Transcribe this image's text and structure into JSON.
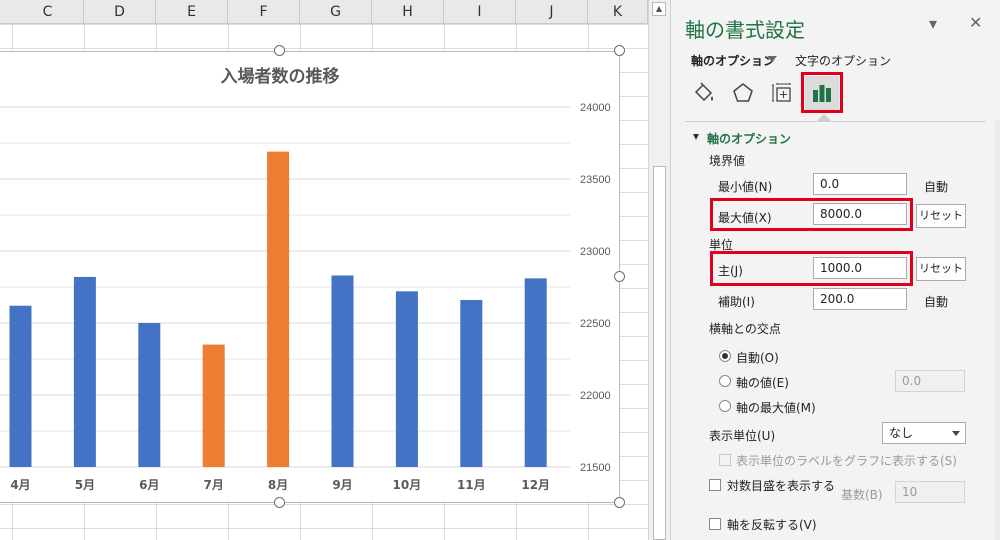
{
  "sheet": {
    "columns": [
      {
        "label": "C",
        "left": 0,
        "width": 96
      },
      {
        "label": "D",
        "left": 84,
        "width": 72
      },
      {
        "label": "E",
        "left": 156,
        "width": 72
      },
      {
        "label": "F",
        "left": 228,
        "width": 72
      },
      {
        "label": "G",
        "left": 300,
        "width": 72
      },
      {
        "label": "H",
        "left": 372,
        "width": 72
      },
      {
        "label": "I",
        "left": 444,
        "width": 72
      },
      {
        "label": "J",
        "left": 516,
        "width": 72
      },
      {
        "label": "K",
        "left": 588,
        "width": 72
      }
    ]
  },
  "chart_data": {
    "type": "bar",
    "title": "入場者数の推移",
    "categories": [
      "4月",
      "5月",
      "6月",
      "7月",
      "8月",
      "9月",
      "10月",
      "11月",
      "12月"
    ],
    "values": [
      22620,
      22820,
      22500,
      22350,
      23690,
      22830,
      22720,
      22660,
      22810
    ],
    "bar_colors": [
      "#4472C4",
      "#4472C4",
      "#4472C4",
      "#ED7D31",
      "#ED7D31",
      "#4472C4",
      "#4472C4",
      "#4472C4",
      "#4472C4"
    ],
    "y_ticks": [
      "24000",
      "23500",
      "23000",
      "22500",
      "22000",
      "21500"
    ],
    "ylim": [
      21500,
      24000
    ],
    "y_axis_position": "right",
    "grid": true
  },
  "pane": {
    "title": "軸の書式設定",
    "tabs": {
      "axis_options": "軸のオプション",
      "text_options": "文字のオプション"
    },
    "section": "軸のオプション",
    "bounds": {
      "label": "境界値",
      "min_label": "最小値(N)",
      "min_value": "0.0",
      "min_mode": "自動",
      "max_label": "最大値(X)",
      "max_value": "8000.0",
      "max_reset": "リセット"
    },
    "units": {
      "label": "単位",
      "major_label": "主(J)",
      "major_value": "1000.0",
      "major_reset": "リセット",
      "minor_label": "補助(I)",
      "minor_value": "200.0",
      "minor_mode": "自動"
    },
    "crosses": {
      "label": "横軸との交点",
      "auto": "自動(O)",
      "axis_value": "軸の値(E)",
      "axis_value_field": "0.0",
      "max_value": "軸の最大値(M)"
    },
    "display_units": {
      "label": "表示単位(U)",
      "selected": "なし",
      "show_label": "表示単位のラベルをグラフに表示する(S)"
    },
    "log_scale": {
      "label": "対数目盛を表示する",
      "base_label": "基数(B)",
      "base_value": "10"
    },
    "reverse": {
      "label": "軸を反転する(V)"
    }
  }
}
